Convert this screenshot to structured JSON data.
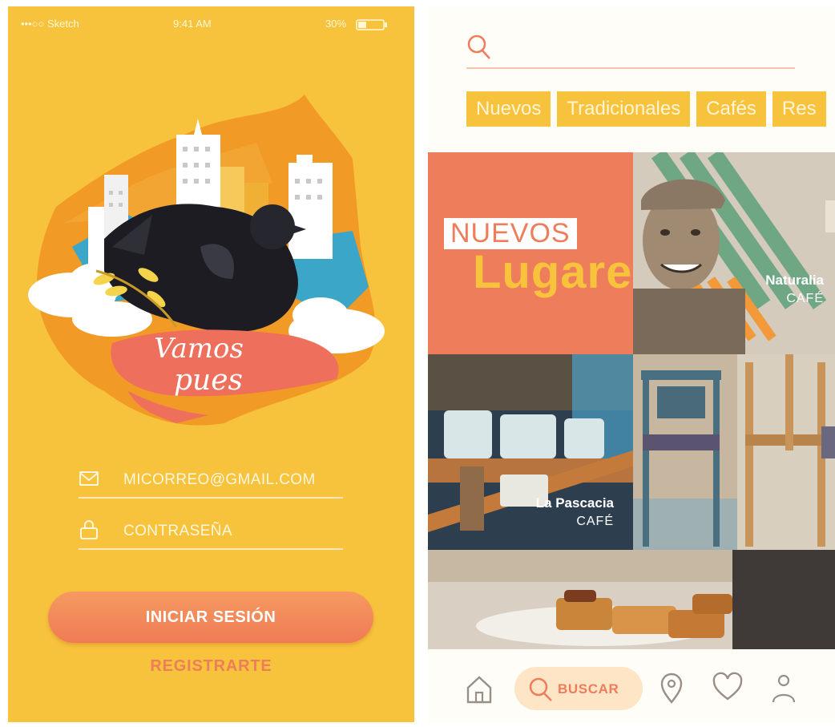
{
  "login": {
    "status": {
      "carrier": "•••○○ Sketch",
      "time": "9:41 AM",
      "battery": "30%"
    },
    "logo_text": [
      "Vamos",
      "pues"
    ],
    "email_field": {
      "value": "MICORREO@GMAIL.COM",
      "icon": "envelope-icon"
    },
    "password_field": {
      "value": "CONTRASEÑA",
      "icon": "lock-icon"
    },
    "login_button": "INICIAR SESIÓN",
    "register_link": "REGISTRARTE",
    "colors": {
      "background": "#F8C33C",
      "accent": "#EE7D5B"
    }
  },
  "search_screen": {
    "search_icon": "search-icon",
    "chips": [
      "Nuevos",
      "Tradicionales",
      "Cafés",
      "Res"
    ],
    "banner": {
      "line1": "NUEVOS",
      "line2": "Lugares"
    },
    "places": [
      {
        "name": "Naturalia",
        "type": "CAFÉ"
      },
      {
        "name": "La Pascacia",
        "type": "CAFÉ"
      }
    ],
    "tabs": [
      {
        "icon": "home-icon",
        "label": ""
      },
      {
        "icon": "search-icon",
        "label": "BUSCAR"
      },
      {
        "icon": "location-pin-icon",
        "label": ""
      },
      {
        "icon": "heart-icon",
        "label": ""
      },
      {
        "icon": "user-icon",
        "label": ""
      }
    ]
  }
}
